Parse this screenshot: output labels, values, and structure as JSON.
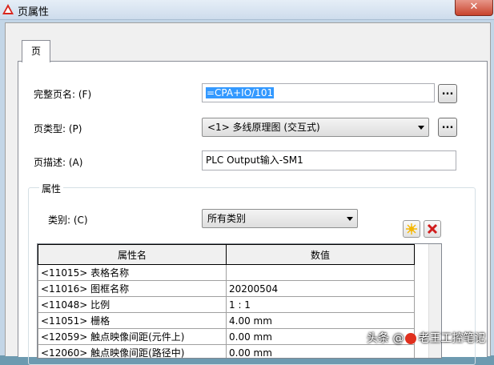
{
  "window": {
    "title": "页属性",
    "close_label": "✕"
  },
  "tabs": [
    {
      "label": "页"
    }
  ],
  "form": {
    "full_name": {
      "label": "完整页名: (F)",
      "value": "=CPA+IO/101"
    },
    "page_type": {
      "label": "页类型: (P)",
      "value": "<1> 多线原理图 (交互式)"
    },
    "page_desc": {
      "label": "页描述: (A)",
      "value": "PLC Output输入-SM1"
    },
    "browse_label": "..."
  },
  "properties": {
    "group_title": "属性",
    "category": {
      "label": "类别: (C)",
      "value": "所有类别"
    },
    "new_icon": "sparkle-new-icon",
    "delete_icon": "red-x-icon",
    "columns": [
      "属性名",
      "数值"
    ],
    "rows": [
      {
        "name": "<11015> 表格名称",
        "value": ""
      },
      {
        "name": "<11016> 图框名称",
        "value": "20200504"
      },
      {
        "name": "<11048> 比例",
        "value": "1 : 1"
      },
      {
        "name": "<11051> 栅格",
        "value": "4.00 mm"
      },
      {
        "name": "<12059> 触点映像间距(元件上)",
        "value": "0.00 mm"
      },
      {
        "name": "<12060> 触点映像间距(路径中)",
        "value": "0.00 mm"
      }
    ]
  },
  "watermark": {
    "prefix": "头条",
    "at": "@",
    "name": "老王工控笔记"
  },
  "colors": {
    "close": "#c8432d",
    "selection": "#3399ff",
    "app_icon": "#d9251c"
  }
}
